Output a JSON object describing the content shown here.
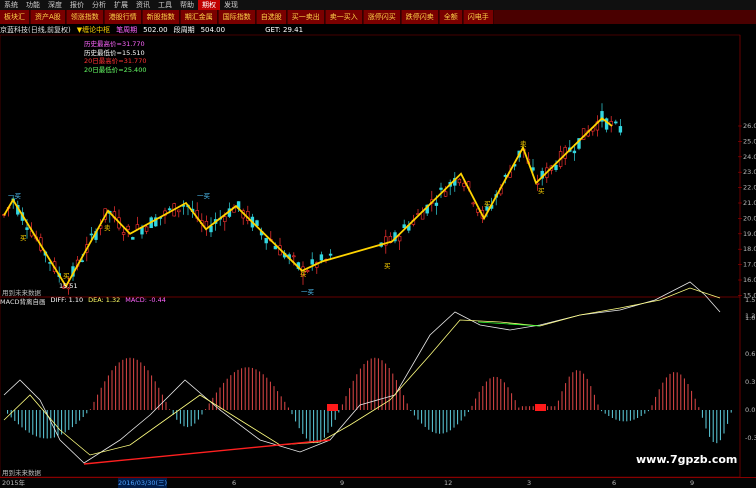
{
  "menu": [
    "系统",
    "功能",
    "深度",
    "报价",
    "分析",
    "扩展",
    "资讯",
    "工具",
    "帮助",
    "期权",
    "发现"
  ],
  "menu_active_index": 9,
  "toolbar": [
    "板块汇",
    "资产A股",
    "领涨指数",
    "港股行情",
    "新股指数",
    "期汇金属",
    "国际指数",
    "自选股",
    "买一卖出",
    "卖一买入",
    "涨停闪买",
    "跌停闪卖",
    "全额",
    "闪电手"
  ],
  "info": {
    "name": "京蓝科技(日线,前复权)",
    "indicator": "▼缠论中枢",
    "tag1": "笔周期",
    "v1": "502.00",
    "tag2": "段周期",
    "v2": "504.00",
    "get": "GET: 29.41"
  },
  "legend": [
    {
      "text": "历史最高价=31.770",
      "color": "#ff66ff"
    },
    {
      "text": "历史最低价=15.510",
      "color": "#ffffff"
    },
    {
      "text": "20日最高价=31.770",
      "color": "#ff3333"
    },
    {
      "text": "20日最低价=25.400",
      "color": "#66ff66"
    }
  ],
  "markers": {
    "lower_mark": "一买",
    "low_value": "15.51",
    "buy_label": "买",
    "sell_label": "卖",
    "wm_top": "用到未来数据",
    "wm_bottom": "用到未来数据"
  },
  "macd": {
    "name": "MACD背离自画",
    "diff": "DIFF: 1.10",
    "dea": "DEA: 1.32",
    "macd": "MACD: -0.44"
  },
  "price_axis": [
    "26.0",
    "25.0",
    "24.0",
    "23.0",
    "22.0",
    "21.0",
    "20.0",
    "19.0",
    "18.0",
    "17.0",
    "16.0",
    "15.0"
  ],
  "macd_axis": [
    "1.5",
    "1.2",
    "1.0",
    "0.6",
    "0.3",
    "0.0",
    "-0.3"
  ],
  "dates": [
    "2015年",
    "2016/03/30(三)",
    "6",
    "9",
    "12",
    "3",
    "6",
    "9"
  ],
  "watermark": "www.7gpzb.com",
  "colors": {
    "up": "#ff3333",
    "down": "#33d6e0",
    "stroke": "#ffd400",
    "diff": "#ffffff",
    "dea": "#ffff66"
  }
}
